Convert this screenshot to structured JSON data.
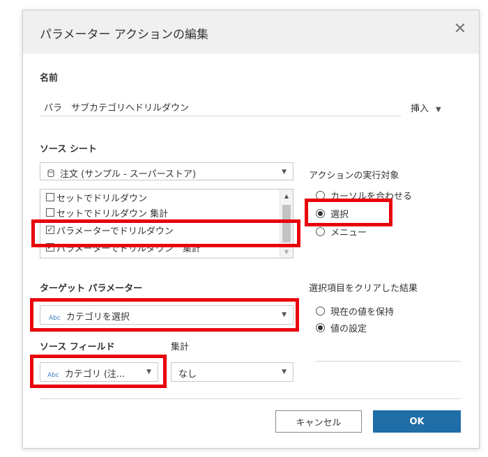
{
  "dialog": {
    "title": "パラメーター アクションの編集",
    "close_glyph": "✕"
  },
  "name": {
    "label": "名前",
    "value": "パラ　サブカテゴリへドリルダウン",
    "insert_label": "挿入",
    "insert_caret": "▼"
  },
  "source_sheets": {
    "label": "ソース シート",
    "datasource": "注文 (サンプル - スーパーストア)",
    "datasource_icon": "database-icon",
    "items": [
      {
        "label": "セットでドリルダウン",
        "checked": false
      },
      {
        "label": "セットでドリルダウン 集計",
        "checked": false
      },
      {
        "label": "パラメーターでドリルダウン",
        "checked": true
      },
      {
        "label": "パラメーターでドリルダウン　集計",
        "checked": true
      }
    ]
  },
  "run_action_on": {
    "label": "アクションの実行対象",
    "options": [
      {
        "label": "カーソルを合わせる",
        "selected": false
      },
      {
        "label": "選択",
        "selected": true
      },
      {
        "label": "メニュー",
        "selected": false
      }
    ]
  },
  "target_parameter": {
    "label": "ターゲット パラメーター",
    "type_badge": "Abc",
    "value": "カテゴリを選択"
  },
  "clearing_selection": {
    "label": "選択項目をクリアした結果",
    "options": [
      {
        "label": "現在の値を保持",
        "selected": false
      },
      {
        "label": "値の設定",
        "selected": true
      }
    ]
  },
  "source_field": {
    "label": "ソース フィールド",
    "type_badge": "Abc",
    "value": "カテゴリ (注..."
  },
  "aggregation": {
    "label": "集計",
    "value": "なし"
  },
  "buttons": {
    "cancel": "キャンセル",
    "ok": "OK"
  },
  "colors": {
    "highlight": "#e8000b",
    "ok_button": "#1f6ea8",
    "abc_badge": "#3a7fc1"
  }
}
